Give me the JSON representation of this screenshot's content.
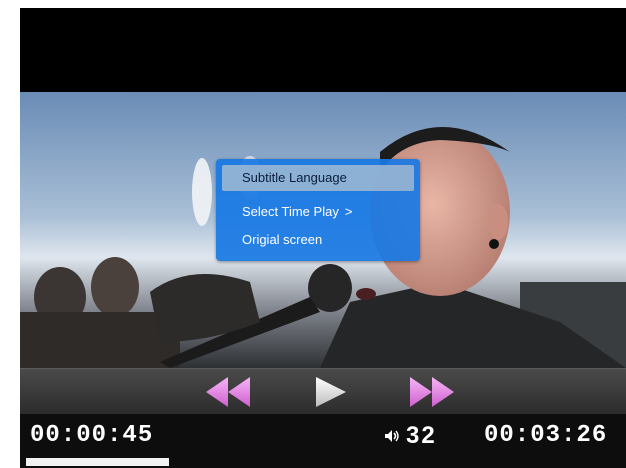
{
  "player": {
    "menu": {
      "items": [
        {
          "label": "Subtitle Language",
          "selected": true
        },
        {
          "label": "Select Time Play",
          "arrow": ">"
        },
        {
          "label": "Origial screen"
        }
      ]
    },
    "controls": {
      "rewind_icon": "rewind-icon",
      "play_icon": "play-icon",
      "fast_forward_icon": "fast-forward-icon",
      "accent_color": "#e07be0"
    },
    "status": {
      "elapsed": "00:00:45",
      "volume": "32",
      "duration": "00:03:26",
      "progress": 0.24
    }
  }
}
